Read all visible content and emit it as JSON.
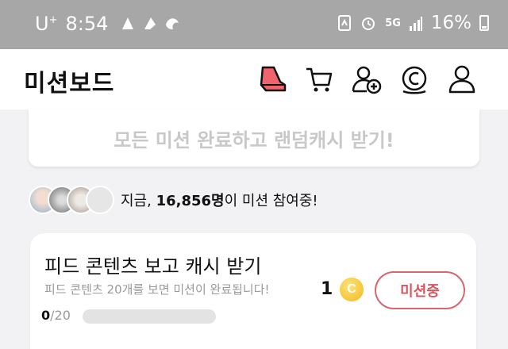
{
  "status_bar": {
    "carrier": "U",
    "carrier_sup": "+",
    "time": "8:54",
    "network": "5G",
    "battery": "16%"
  },
  "header": {
    "title": "미션보드",
    "icons": [
      "sneaker-icon",
      "cart-icon",
      "add-friend-icon",
      "coin-icon",
      "profile-icon"
    ]
  },
  "banner": {
    "text": "모든 미션 완료하고 랜덤캐시 받기!"
  },
  "participants": {
    "prefix": "지금, ",
    "count": "16,856명",
    "suffix": "이 미션 참여중!"
  },
  "mission": {
    "title": "피드 콘텐츠 보고 캐시 받기",
    "description": "피드 콘텐츠 20개를 보면 미션이 완료됩니다!",
    "progress_current": "0",
    "progress_total": "/20",
    "progress_fraction": 0,
    "reward_amount": "1",
    "coin_symbol": "C",
    "button_label": "미션중"
  },
  "colors": {
    "accent": "#d9555f",
    "statusbar": "#a7a7a7",
    "coin": "#f3b81a"
  }
}
